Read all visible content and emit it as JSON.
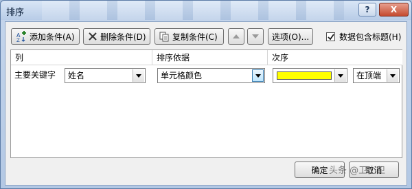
{
  "window": {
    "title": "排序",
    "help_label": "?",
    "close_label": "X"
  },
  "toolbar": {
    "add_label": "添加条件(A)",
    "delete_label": "删除条件(D)",
    "copy_label": "复制条件(C)",
    "options_label": "选项(O)...",
    "header_checkbox_label": "数据包含标题(H)",
    "header_checked": true
  },
  "grid": {
    "headers": [
      "列",
      "排序依据",
      "次序"
    ],
    "rows": [
      {
        "label": "主要关键字",
        "field": "姓名",
        "sort_on": "单元格颜色",
        "order_color": "#ffff00",
        "order_position": "在顶端"
      }
    ]
  },
  "footer": {
    "ok_label": "确定",
    "cancel_label": "取消"
  },
  "watermark": "头条 @卫小卫"
}
